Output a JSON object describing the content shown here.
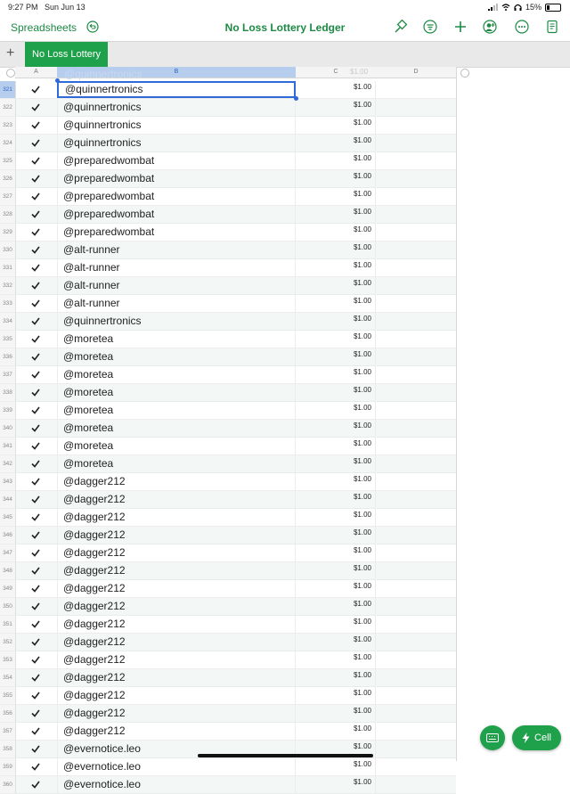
{
  "status": {
    "time": "9:27 PM",
    "date": "Sun Jun 13",
    "battery": "15%"
  },
  "toolbar": {
    "back_label": "Spreadsheets",
    "title": "No Loss Lottery Ledger"
  },
  "sheet": {
    "tab_label": "No Loss Lottery"
  },
  "columns": [
    "A",
    "B",
    "C",
    "D"
  ],
  "ghost_row": {
    "name": "@quinnertronics",
    "amount": "$1.00"
  },
  "rows": [
    {
      "n": "321",
      "name": "@quinnertronics",
      "amount": "$1.00"
    },
    {
      "n": "322",
      "name": "@quinnertronics",
      "amount": "$1.00"
    },
    {
      "n": "323",
      "name": "@quinnertronics",
      "amount": "$1.00"
    },
    {
      "n": "324",
      "name": "@quinnertronics",
      "amount": "$1.00"
    },
    {
      "n": "325",
      "name": "@preparedwombat",
      "amount": "$1.00"
    },
    {
      "n": "326",
      "name": "@preparedwombat",
      "amount": "$1.00"
    },
    {
      "n": "327",
      "name": "@preparedwombat",
      "amount": "$1.00"
    },
    {
      "n": "328",
      "name": "@preparedwombat",
      "amount": "$1.00"
    },
    {
      "n": "329",
      "name": "@preparedwombat",
      "amount": "$1.00"
    },
    {
      "n": "330",
      "name": "@alt-runner",
      "amount": "$1.00"
    },
    {
      "n": "331",
      "name": "@alt-runner",
      "amount": "$1.00"
    },
    {
      "n": "332",
      "name": "@alt-runner",
      "amount": "$1.00"
    },
    {
      "n": "333",
      "name": "@alt-runner",
      "amount": "$1.00"
    },
    {
      "n": "334",
      "name": "@quinnertronics",
      "amount": "$1.00"
    },
    {
      "n": "335",
      "name": "@moretea",
      "amount": "$1.00"
    },
    {
      "n": "336",
      "name": "@moretea",
      "amount": "$1.00"
    },
    {
      "n": "337",
      "name": "@moretea",
      "amount": "$1.00"
    },
    {
      "n": "338",
      "name": "@moretea",
      "amount": "$1.00"
    },
    {
      "n": "339",
      "name": "@moretea",
      "amount": "$1.00"
    },
    {
      "n": "340",
      "name": "@moretea",
      "amount": "$1.00"
    },
    {
      "n": "341",
      "name": "@moretea",
      "amount": "$1.00"
    },
    {
      "n": "342",
      "name": "@moretea",
      "amount": "$1.00"
    },
    {
      "n": "343",
      "name": "@dagger212",
      "amount": "$1.00"
    },
    {
      "n": "344",
      "name": "@dagger212",
      "amount": "$1.00"
    },
    {
      "n": "345",
      "name": "@dagger212",
      "amount": "$1.00"
    },
    {
      "n": "346",
      "name": "@dagger212",
      "amount": "$1.00"
    },
    {
      "n": "347",
      "name": "@dagger212",
      "amount": "$1.00"
    },
    {
      "n": "348",
      "name": "@dagger212",
      "amount": "$1.00"
    },
    {
      "n": "349",
      "name": "@dagger212",
      "amount": "$1.00"
    },
    {
      "n": "350",
      "name": "@dagger212",
      "amount": "$1.00"
    },
    {
      "n": "351",
      "name": "@dagger212",
      "amount": "$1.00"
    },
    {
      "n": "352",
      "name": "@dagger212",
      "amount": "$1.00"
    },
    {
      "n": "353",
      "name": "@dagger212",
      "amount": "$1.00"
    },
    {
      "n": "354",
      "name": "@dagger212",
      "amount": "$1.00"
    },
    {
      "n": "355",
      "name": "@dagger212",
      "amount": "$1.00"
    },
    {
      "n": "356",
      "name": "@dagger212",
      "amount": "$1.00"
    },
    {
      "n": "357",
      "name": "@dagger212",
      "amount": "$1.00"
    },
    {
      "n": "358",
      "name": "@evernotice.leo",
      "amount": "$1.00"
    },
    {
      "n": "359",
      "name": "@evernotice.leo",
      "amount": "$1.00"
    },
    {
      "n": "360",
      "name": "@evernotice.leo",
      "amount": "$1.00"
    }
  ],
  "fab": {
    "cell_label": "Cell"
  },
  "colors": {
    "accent": "#1fa04a",
    "selection": "#2f6ad9"
  }
}
